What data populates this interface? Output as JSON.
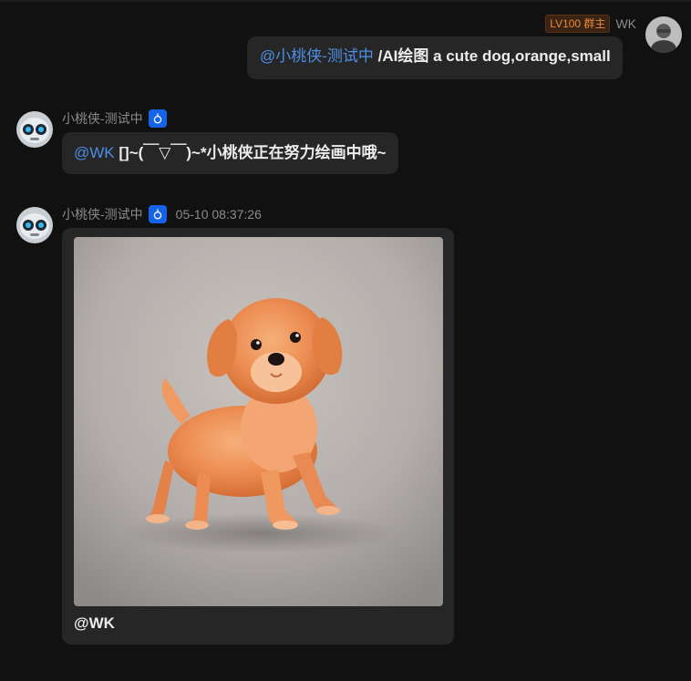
{
  "self_message": {
    "badge": "LV100 群主",
    "sender": "WK",
    "mention": "@小桃侠-测试中",
    "command": " /AI绘图 a cute dog,orange,small"
  },
  "bot_reply": {
    "sender": "小桃侠-测试中",
    "mention": "@WK",
    "text": " []~(￣▽￣)~*小桃侠正在努力绘画中哦~"
  },
  "bot_image_message": {
    "sender": "小桃侠-测试中",
    "timestamp": "05-10 08:37:26",
    "caption": "@WK"
  },
  "icons": {
    "bot_tag": "bot-badge-icon",
    "bot_avatar": "robot-avatar",
    "user_avatar": "user-avatar"
  },
  "colors": {
    "background": "#111111",
    "bubble": "#262626",
    "mention": "#4d8fe6",
    "badge_text": "#e8893a",
    "bot_tag": "#1463e8"
  }
}
